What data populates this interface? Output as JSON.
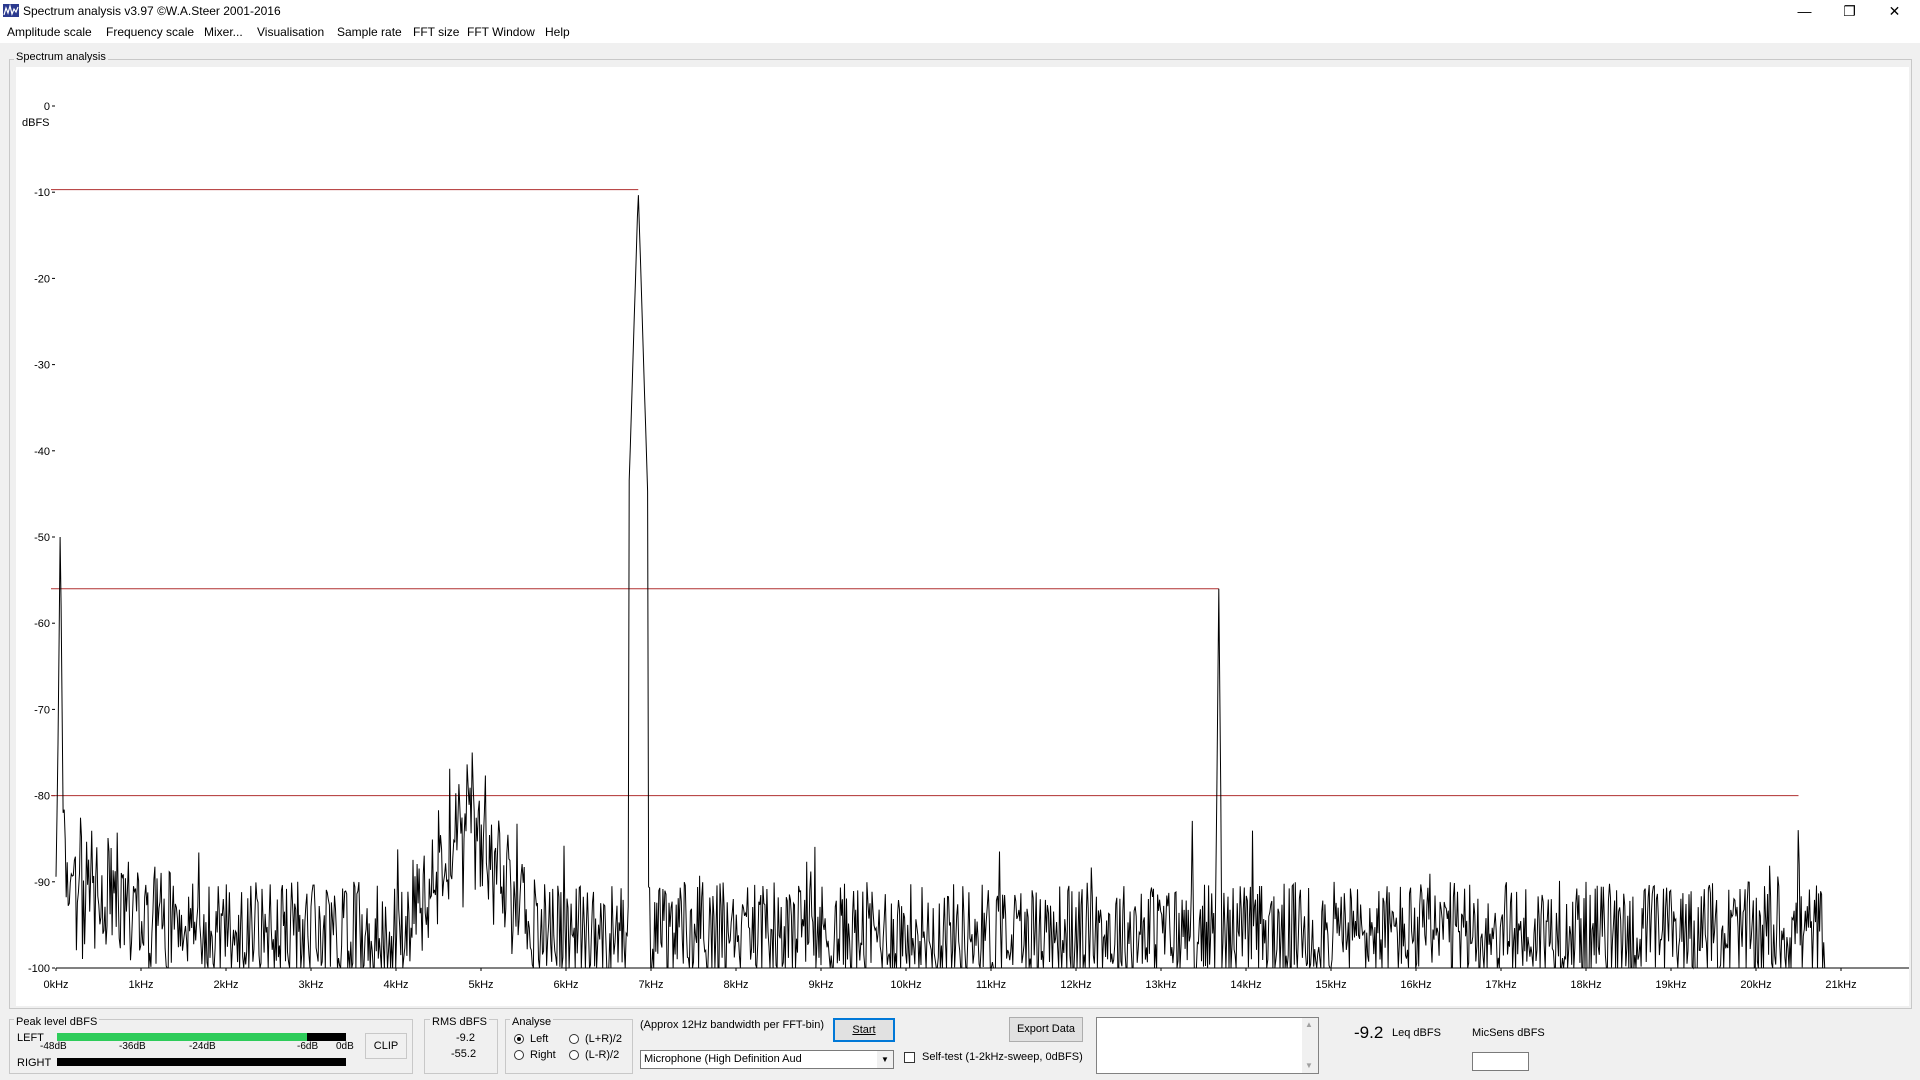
{
  "window": {
    "title": "Spectrum analysis v3.97  ©W.A.Steer 2001-2016",
    "controls": {
      "minimize": "—",
      "restore": "❐",
      "close": "✕"
    }
  },
  "menu": [
    "Amplitude scale",
    "Frequency scale",
    "Mixer...",
    "Visualisation",
    "Sample rate",
    "FFT size",
    "FFT Window",
    "Help"
  ],
  "plot_panel": {
    "label": "Spectrum analysis"
  },
  "chart_data": {
    "type": "line",
    "ylabel": "dBFS",
    "ylim": [
      -100,
      0
    ],
    "xlim_khz": [
      0,
      21.8
    ],
    "y_ticks": [
      "0",
      "-10",
      "-20",
      "-30",
      "-40",
      "-50",
      "-60",
      "-70",
      "-80",
      "-90",
      "-100"
    ],
    "x_ticks": [
      "0kHz",
      "1kHz",
      "2kHz",
      "3kHz",
      "4kHz",
      "5kHz",
      "6kHz",
      "7kHz",
      "8kHz",
      "9kHz",
      "10kHz",
      "11kHz",
      "12kHz",
      "13kHz",
      "14kHz",
      "15kHz",
      "16kHz",
      "17kHz",
      "18kHz",
      "19kHz",
      "20kHz",
      "21kHz"
    ],
    "peaks": [
      {
        "freq_khz": 0.05,
        "level_db": -48
      },
      {
        "freq_khz": 4.9,
        "level_db": -71
      },
      {
        "freq_khz": 6.85,
        "level_db": -9.7
      },
      {
        "freq_khz": 13.68,
        "level_db": -56
      },
      {
        "freq_khz": 20.5,
        "level_db": -80
      }
    ],
    "markers": [
      {
        "level_db": -9.7,
        "to_khz": 6.85
      },
      {
        "level_db": -56,
        "to_khz": 13.68
      },
      {
        "level_db": -80,
        "to_khz": 20.5
      }
    ],
    "noise_floor_db": -93,
    "trace_color": "#000000",
    "marker_color": "#b03030"
  },
  "peak_level": {
    "title": "Peak level dBFS",
    "left_label": "LEFT",
    "right_label": "RIGHT",
    "scale": [
      "-48dB",
      "-36dB",
      "-24dB",
      "-6dB",
      "0dB"
    ],
    "clip_label": "CLIP",
    "left_level_db": -6.5,
    "right_level_db": -100,
    "fill_color": "#2ecc5a"
  },
  "rms": {
    "title": "RMS dBFS",
    "left": "-9.2",
    "right": "-55.2"
  },
  "analyse": {
    "title": "Analyse",
    "options": [
      "Left",
      "Right",
      "(L+R)/2",
      "(L-R)/2"
    ],
    "selected": "Left"
  },
  "controls": {
    "bandwidth_text": "(Approx 12Hz bandwidth per FFT-bin)",
    "start_label": "Start",
    "input_device": "Microphone (High Definition Aud",
    "selftest_label": "Self-test  (1-2kHz-sweep, 0dBFS)",
    "export_label": "Export Data"
  },
  "leq": {
    "value": "-9.2",
    "unit": "Leq dBFS"
  },
  "micsens": {
    "label": "MicSens dBFS",
    "value": ""
  }
}
